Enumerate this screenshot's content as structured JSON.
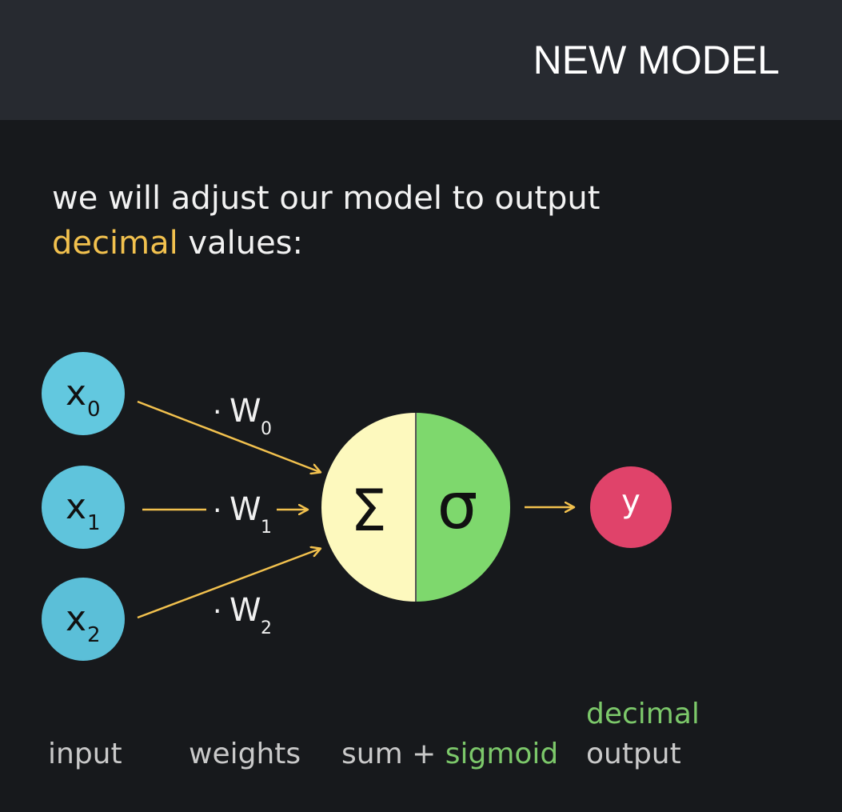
{
  "header": {
    "title": "NEW MODEL"
  },
  "intro": {
    "line1": "we will adjust our model to output",
    "highlight": "decimal",
    "rest": " values:"
  },
  "colors": {
    "header_bg": "#272a30",
    "page_bg": "#17191c",
    "input_node": "#62c8df",
    "arrow": "#f2c14e",
    "sum_half": "#fdf9be",
    "sigmoid_half": "#7ed86d",
    "output_node": "#e0436a",
    "highlight": "#f2c14e",
    "green_text": "#7cc86a"
  },
  "diagram": {
    "inputs": [
      {
        "base": "x",
        "sub": "0"
      },
      {
        "base": "x",
        "sub": "1"
      },
      {
        "base": "x",
        "sub": "2"
      }
    ],
    "weights": [
      {
        "prefix": "·",
        "base": "W",
        "sub": "0"
      },
      {
        "prefix": "·",
        "base": "W",
        "sub": "1"
      },
      {
        "prefix": "·",
        "base": "W",
        "sub": "2"
      }
    ],
    "sum_symbol": "Σ",
    "sigmoid_symbol": "σ",
    "output": "y"
  },
  "captions": {
    "input": "input",
    "weights": "weights",
    "sum": "sum + ",
    "sigmoid": "sigmoid",
    "output_top": "decimal",
    "output_bottom": "output"
  }
}
